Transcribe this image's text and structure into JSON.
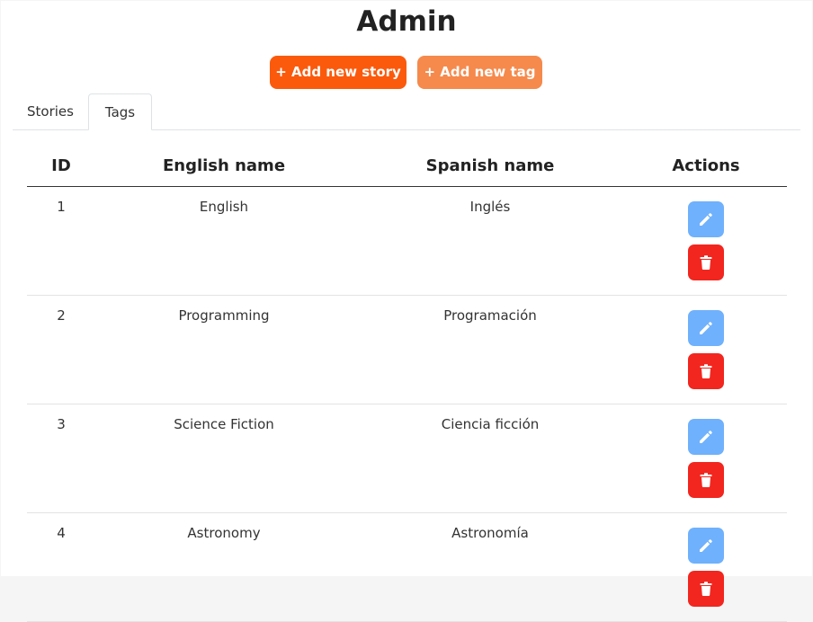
{
  "page": {
    "title": "Admin"
  },
  "toolbar": {
    "add_story_label": "+ Add new story",
    "add_tag_label": "+ Add new tag"
  },
  "tabs": [
    {
      "label": "Stories",
      "active": false
    },
    {
      "label": "Tags",
      "active": true
    }
  ],
  "table": {
    "headers": {
      "id": "ID",
      "english": "English name",
      "spanish": "Spanish name",
      "actions": "Actions"
    },
    "rows": [
      {
        "id": "1",
        "english": "English",
        "spanish": "Inglés"
      },
      {
        "id": "2",
        "english": "Programming",
        "spanish": "Programación"
      },
      {
        "id": "3",
        "english": "Science Fiction",
        "spanish": "Ciencia ficción"
      },
      {
        "id": "4",
        "english": "Astronomy",
        "spanish": "Astronomía"
      }
    ],
    "row_actions": [
      {
        "name": "edit",
        "icon": "pencil-icon",
        "color": "#6fb1fc"
      },
      {
        "name": "delete",
        "icon": "trash-icon",
        "color": "#f2261f"
      }
    ]
  },
  "colors": {
    "primary": "#fb5a0c",
    "secondary": "#f58a4c",
    "edit": "#6fb1fc",
    "delete": "#f2261f"
  }
}
